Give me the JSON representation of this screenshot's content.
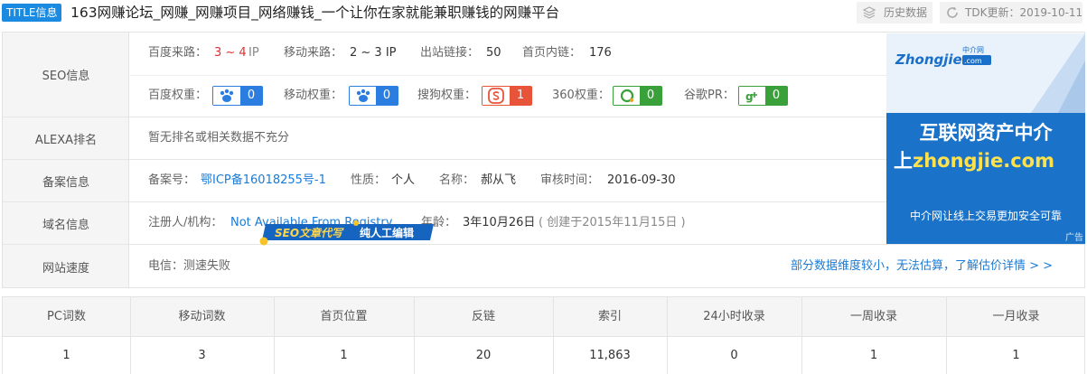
{
  "title": {
    "badge": "TITLE信息",
    "text": "163网赚论坛_网赚_网赚项目_网络赚钱_一个让你在家就能兼职赚钱的网赚平台"
  },
  "toolbar": {
    "history_label": "历史数据",
    "tdk_label": "TDK更新：2019-10-11"
  },
  "seo": {
    "label": "SEO信息",
    "baidu_traffic_label": "百度来路：",
    "baidu_traffic_value": "3 ~ 4",
    "ip_unit": "IP",
    "mobile_traffic_label": "移动来路：",
    "mobile_traffic_value": "2 ~ 3 IP",
    "outlinks_label": "出站链接：",
    "outlinks_value": "50",
    "inlinks_label": "首页内链：",
    "inlinks_value": "176",
    "baidu_weight_label": "百度权重：",
    "baidu_weight_value": "0",
    "mobile_weight_label": "移动权重：",
    "mobile_weight_value": "0",
    "sogou_weight_label": "搜狗权重：",
    "sogou_weight_value": "1",
    "w360_label": "360权重：",
    "w360_value": "0",
    "google_pr_label": "谷歌PR：",
    "google_pr_value": "0"
  },
  "alexa": {
    "label": "ALEXA排名",
    "value": "暂无排名或相关数据不充分"
  },
  "icp": {
    "label": "备案信息",
    "no_label": "备案号：",
    "no_value": "鄂ICP备16018255号-1",
    "nature_label": "性质：",
    "nature_value": "个人",
    "name_label": "名称：",
    "name_value": "郝从飞",
    "audit_label": "审核时间：",
    "audit_value": "2016-09-30"
  },
  "domain": {
    "label": "域名信息",
    "registrant_label": "注册人/机构：",
    "registrant_value": "Not Available From Registry",
    "age_label": "年龄：",
    "age_value": "3年10月26日",
    "created_value": "( 创建于2015年11月15日 )"
  },
  "speed": {
    "label": "网站速度",
    "telecom_value": "电信：测速失败",
    "tag_part1": "SEO文章代写",
    "tag_part2": "纯人工编辑",
    "right_link": "部分数据维度较小，无法估算，了解估价详情 > >"
  },
  "ad": {
    "logo_text": "Zhongjie",
    "logo_small": "中介网",
    "logo_com": ".com",
    "line1": "互联网资产中介",
    "line2_prefix": "上",
    "line2_domain": "zhongjie.com",
    "line3": "中介网让线上交易更加安全可靠",
    "tag": "广告"
  },
  "stats": {
    "headers": [
      "PC词数",
      "移动词数",
      "首页位置",
      "反链",
      "索引",
      "24小时收录",
      "一周收录",
      "一月收录"
    ],
    "values": [
      "1",
      "3",
      "1",
      "20",
      "11,863",
      "0",
      "1",
      "1"
    ]
  },
  "colors": {
    "accent": "#1a8be0",
    "baidu_blue": "#2b7de0",
    "sogou_red": "#e8543a",
    "green": "#3aa03a",
    "link": "#1a7bd6"
  }
}
